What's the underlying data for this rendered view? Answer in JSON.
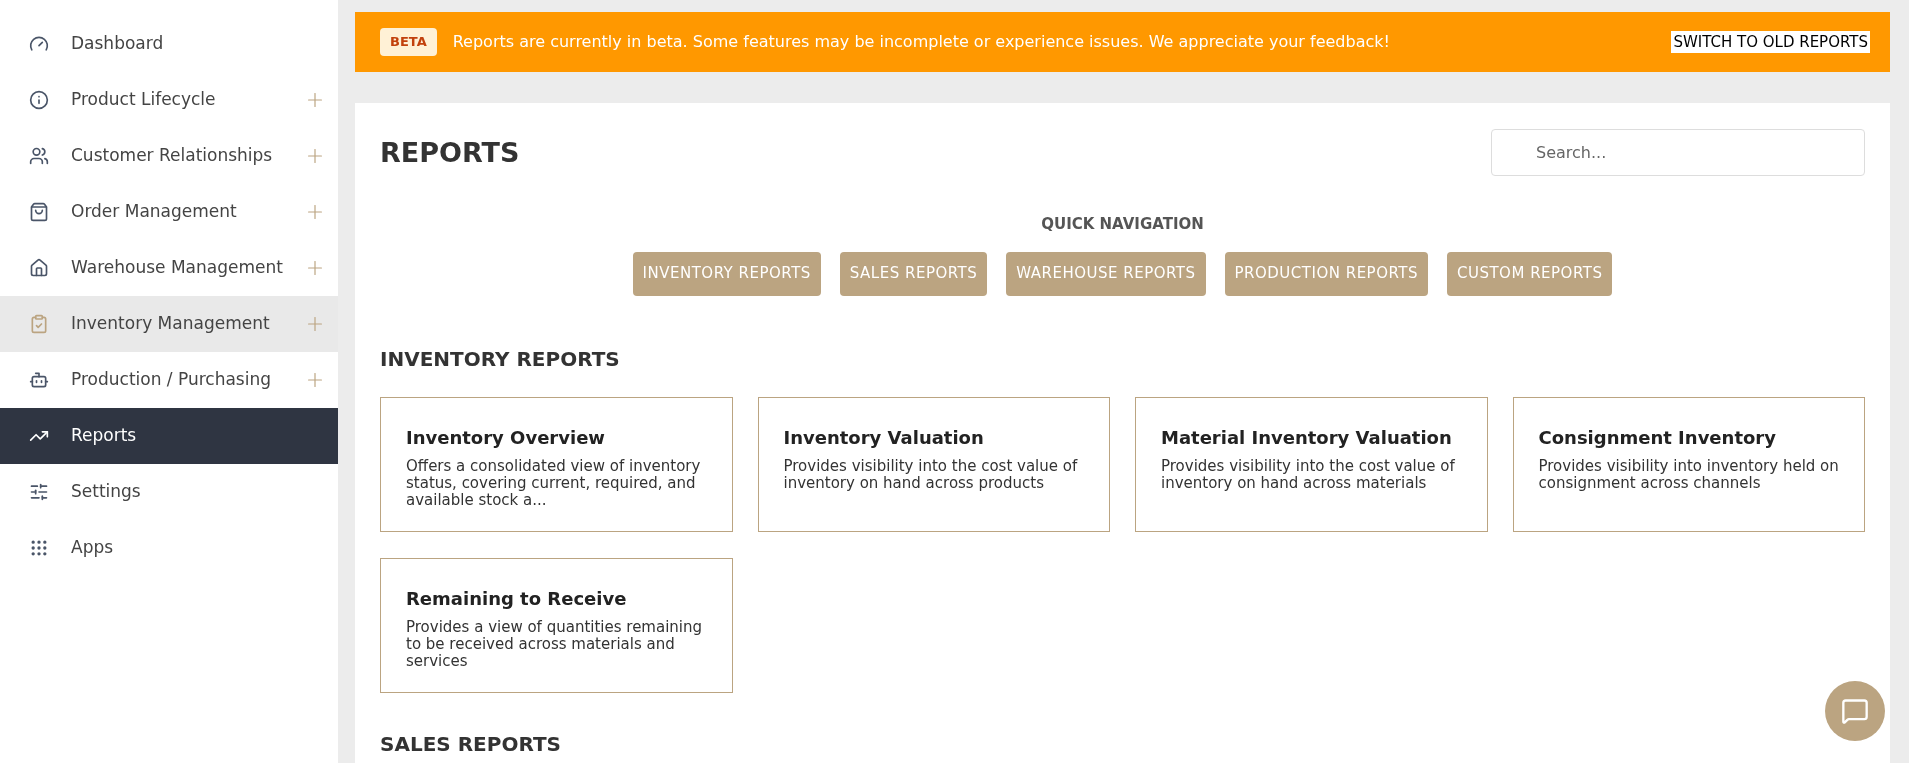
{
  "sidebar": {
    "items": [
      {
        "label": "Dashboard",
        "expandable": false,
        "selected": false,
        "hovered": false
      },
      {
        "label": "Product Lifecycle",
        "expandable": true,
        "selected": false,
        "hovered": false
      },
      {
        "label": "Customer Relationships",
        "expandable": true,
        "selected": false,
        "hovered": false
      },
      {
        "label": "Order Management",
        "expandable": true,
        "selected": false,
        "hovered": false
      },
      {
        "label": "Warehouse Management",
        "expandable": true,
        "selected": false,
        "hovered": false
      },
      {
        "label": "Inventory Management",
        "expandable": true,
        "selected": false,
        "hovered": true
      },
      {
        "label": "Production / Purchasing",
        "expandable": true,
        "selected": false,
        "hovered": false
      },
      {
        "label": "Reports",
        "expandable": false,
        "selected": true,
        "hovered": false
      },
      {
        "label": "Settings",
        "expandable": false,
        "selected": false,
        "hovered": false
      },
      {
        "label": "Apps",
        "expandable": false,
        "selected": false,
        "hovered": false
      }
    ]
  },
  "banner": {
    "badge": "BETA",
    "message": "Reports are currently in beta. Some features may be incomplete or experience issues. We appreciate your feedback!",
    "action": "SWITCH TO OLD REPORTS"
  },
  "page": {
    "title": "REPORTS",
    "search": {
      "placeholder": "Search..."
    }
  },
  "quick_navigation": {
    "title": "QUICK NAVIGATION",
    "buttons": [
      "INVENTORY REPORTS",
      "SALES REPORTS",
      "WAREHOUSE REPORTS",
      "PRODUCTION REPORTS",
      "CUSTOM REPORTS"
    ]
  },
  "sections": [
    {
      "title": "INVENTORY REPORTS",
      "cards": [
        {
          "title": "Inventory Overview",
          "description": "Offers a consolidated view of inventory status, covering current, required, and available stock a..."
        },
        {
          "title": "Inventory Valuation",
          "description": "Provides visibility into the cost value of inventory on hand across products"
        },
        {
          "title": "Material Inventory Valuation",
          "description": "Provides visibility into the cost value of inventory on hand across materials"
        },
        {
          "title": "Consignment Inventory",
          "description": "Provides visibility into inventory held on consignment across channels"
        },
        {
          "title": "Remaining to Receive",
          "description": "Provides a view of quantities remaining to be received across materials and services"
        }
      ]
    },
    {
      "title": "SALES REPORTS"
    }
  ]
}
